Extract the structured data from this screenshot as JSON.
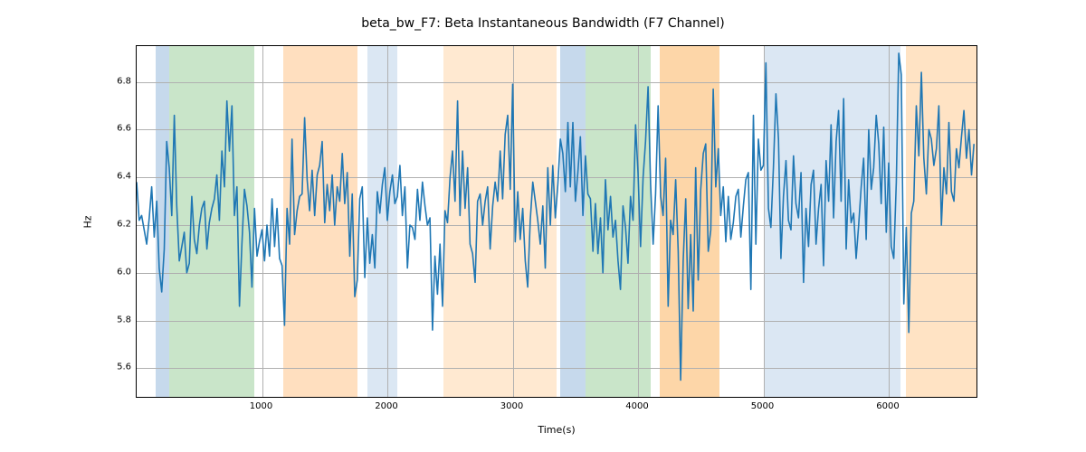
{
  "chart_data": {
    "type": "line",
    "title": "beta_bw_F7: Beta Instantaneous Bandwidth (F7 Channel)",
    "xlabel": "Time(s)",
    "ylabel": "Hz",
    "xlim": [
      0,
      6700
    ],
    "ylim": [
      5.48,
      6.95
    ],
    "xticks": [
      1000,
      2000,
      3000,
      4000,
      5000,
      6000
    ],
    "yticks": [
      5.6,
      5.8,
      6.0,
      6.2,
      6.4,
      6.6,
      6.8
    ],
    "bands": [
      {
        "x0": 150,
        "x1": 260,
        "color": "#c6d9ec"
      },
      {
        "x0": 260,
        "x1": 940,
        "color": "#c9e5c9"
      },
      {
        "x0": 1170,
        "x1": 1760,
        "color": "#ffdfbf"
      },
      {
        "x0": 1840,
        "x1": 2080,
        "color": "#dbe7f3"
      },
      {
        "x0": 2450,
        "x1": 3350,
        "color": "#ffe9d1"
      },
      {
        "x0": 3380,
        "x1": 3580,
        "color": "#c6d9ec"
      },
      {
        "x0": 3580,
        "x1": 4100,
        "color": "#c9e5c9"
      },
      {
        "x0": 4170,
        "x1": 4650,
        "color": "#fdd6a8"
      },
      {
        "x0": 5000,
        "x1": 6090,
        "color": "#dbe7f3"
      },
      {
        "x0": 6140,
        "x1": 6700,
        "color": "#ffe3c4"
      }
    ],
    "series": [
      {
        "name": "beta_bw_F7",
        "color": "#1f77b4",
        "x_step": 20,
        "y": [
          6.38,
          6.22,
          6.24,
          6.18,
          6.12,
          6.23,
          6.36,
          6.15,
          6.3,
          6.02,
          5.92,
          6.1,
          6.55,
          6.44,
          6.24,
          6.66,
          6.28,
          6.05,
          6.11,
          6.17,
          6.0,
          6.04,
          6.32,
          6.14,
          6.08,
          6.2,
          6.27,
          6.3,
          6.1,
          6.21,
          6.27,
          6.31,
          6.41,
          6.22,
          6.51,
          6.36,
          6.72,
          6.51,
          6.7,
          6.24,
          6.36,
          5.86,
          6.12,
          6.35,
          6.28,
          6.17,
          5.94,
          6.27,
          6.07,
          6.13,
          6.18,
          6.05,
          6.2,
          6.07,
          6.31,
          6.11,
          6.27,
          6.06,
          6.03,
          5.78,
          6.27,
          6.12,
          6.56,
          6.16,
          6.26,
          6.32,
          6.33,
          6.65,
          6.39,
          6.26,
          6.43,
          6.24,
          6.41,
          6.45,
          6.55,
          6.21,
          6.37,
          6.26,
          6.41,
          6.2,
          6.36,
          6.3,
          6.5,
          6.29,
          6.42,
          6.07,
          6.33,
          5.9,
          5.97,
          6.31,
          6.36,
          5.98,
          6.23,
          6.04,
          6.16,
          6.02,
          6.34,
          6.25,
          6.37,
          6.44,
          6.22,
          6.34,
          6.41,
          6.29,
          6.32,
          6.45,
          6.24,
          6.36,
          6.02,
          6.2,
          6.19,
          6.14,
          6.35,
          6.22,
          6.38,
          6.28,
          6.2,
          6.23,
          5.76,
          6.07,
          5.91,
          6.12,
          5.86,
          6.26,
          6.21,
          6.4,
          6.51,
          6.3,
          6.72,
          6.24,
          6.51,
          6.27,
          6.44,
          6.12,
          6.08,
          5.96,
          6.3,
          6.33,
          6.2,
          6.3,
          6.36,
          6.1,
          6.28,
          6.38,
          6.3,
          6.51,
          6.31,
          6.58,
          6.66,
          6.35,
          6.79,
          6.13,
          6.34,
          6.14,
          6.27,
          6.05,
          5.94,
          6.22,
          6.38,
          6.3,
          6.22,
          6.12,
          6.28,
          6.02,
          6.44,
          6.2,
          6.45,
          6.23,
          6.37,
          6.56,
          6.5,
          6.34,
          6.63,
          6.36,
          6.63,
          6.3,
          6.42,
          6.57,
          6.24,
          6.49,
          6.33,
          6.31,
          6.09,
          6.29,
          6.08,
          6.23,
          6.0,
          6.39,
          6.18,
          6.32,
          6.15,
          6.22,
          6.05,
          5.93,
          6.28,
          6.19,
          6.04,
          6.32,
          6.22,
          6.62,
          6.42,
          6.11,
          6.4,
          6.55,
          6.78,
          6.37,
          6.12,
          6.33,
          6.7,
          6.32,
          6.24,
          6.48,
          5.86,
          6.22,
          6.16,
          6.39,
          6.09,
          5.55,
          6.05,
          6.31,
          5.85,
          6.16,
          5.84,
          6.44,
          5.97,
          6.35,
          6.5,
          6.54,
          6.09,
          6.18,
          6.77,
          6.36,
          6.52,
          6.24,
          6.36,
          6.13,
          6.32,
          6.14,
          6.21,
          6.32,
          6.35,
          6.15,
          6.28,
          6.39,
          6.42,
          5.93,
          6.66,
          6.12,
          6.56,
          6.43,
          6.45,
          6.88,
          6.27,
          6.19,
          6.44,
          6.75,
          6.56,
          6.06,
          6.32,
          6.47,
          6.22,
          6.18,
          6.49,
          6.29,
          6.23,
          6.42,
          5.96,
          6.27,
          6.11,
          6.37,
          6.43,
          6.12,
          6.27,
          6.37,
          6.03,
          6.47,
          6.3,
          6.62,
          6.23,
          6.55,
          6.68,
          6.3,
          6.73,
          6.1,
          6.39,
          6.21,
          6.25,
          6.06,
          6.2,
          6.36,
          6.48,
          6.14,
          6.6,
          6.35,
          6.44,
          6.66,
          6.54,
          6.29,
          6.61,
          6.17,
          6.46,
          6.11,
          6.06,
          6.38,
          6.92,
          6.83,
          5.87,
          6.19,
          5.75,
          6.25,
          6.3,
          6.7,
          6.49,
          6.84,
          6.48,
          6.33,
          6.6,
          6.56,
          6.45,
          6.52,
          6.7,
          6.2,
          6.44,
          6.33,
          6.63,
          6.34,
          6.3,
          6.52,
          6.44,
          6.57,
          6.68,
          6.48,
          6.6,
          6.41,
          6.54
        ]
      }
    ]
  }
}
